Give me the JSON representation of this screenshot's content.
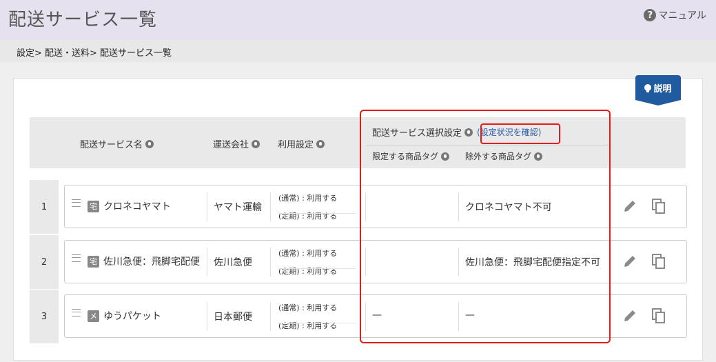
{
  "header": {
    "title": "配送サービス一覧",
    "manual_label": "マニュアル",
    "manual_icon": "help-icon"
  },
  "breadcrumb": "設定> 配送・送料> 配送サービス一覧",
  "explain_button": "説明",
  "table": {
    "columns": {
      "service_name": "配送サービス名",
      "carrier": "運送会社",
      "usage": "利用設定",
      "selection": "配送サービス選択設定",
      "confirm_link": "(設定状況を確認)",
      "limited_tags": "限定する商品タグ",
      "excluded_tags": "除外する商品タグ"
    },
    "rows": [
      {
        "num": "1",
        "badge": "宅",
        "name": "クロネコヤマト",
        "carrier": "ヤマト運輸",
        "usage_normal": "(通常) :  利用する",
        "usage_regular": "(定期) :  利用する",
        "limited": "",
        "excluded": "クロネコヤマト不可"
      },
      {
        "num": "2",
        "badge": "宅",
        "name": "佐川急便：飛脚宅配便",
        "carrier": "佐川急便",
        "usage_normal": "(通常) :  利用する",
        "usage_regular": "(定期) :  利用する",
        "limited": "",
        "excluded": "佐川急便：飛脚宅配便指定不可"
      },
      {
        "num": "3",
        "badge": "メ",
        "name": "ゆうパケット",
        "carrier": "日本郵便",
        "usage_normal": "(通常) :  利用する",
        "usage_regular": "(定期) :  利用する",
        "limited": "—",
        "excluded": "—"
      }
    ]
  },
  "colors": {
    "header_bg": "#e6e1ee",
    "accent": "#1f5b9e",
    "highlight": "#e41b1b",
    "link": "#2b5aa6"
  }
}
